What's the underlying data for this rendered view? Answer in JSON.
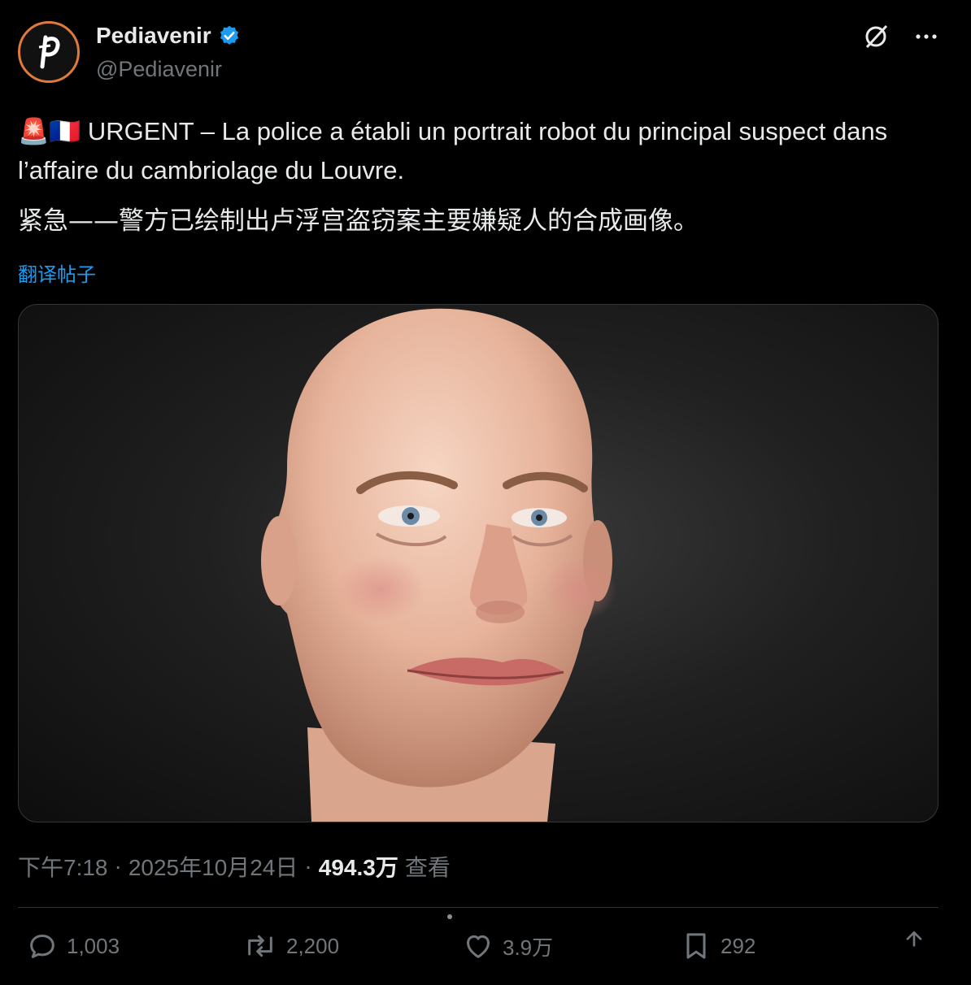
{
  "header": {
    "display_name": "Pediavenir",
    "handle": "@Pediavenir",
    "avatar_letter": "p",
    "verified": true,
    "accent_color": "#1d9bf0"
  },
  "tweet": {
    "emoji_prefix": "🚨🇫🇷",
    "text_fr": "URGENT – La police a établi un portrait robot du principal suspect dans l’affaire du cambriolage du Louvre.",
    "text_zh": "紧急——警方已绘制出卢浮宫盗窃案主要嫌疑人的合成画像。",
    "translate_link": "翻译帖子"
  },
  "meta": {
    "time": "下午7:18",
    "date": "2025年10月24日",
    "views_count": "494.3万",
    "views_label": "查看",
    "separator": "·"
  },
  "actions": {
    "replies": "1,003",
    "reposts": "2,200",
    "likes": "3.9万",
    "bookmarks": "292"
  },
  "icons": [
    "grok-icon",
    "more-icon",
    "reply-icon",
    "repost-icon",
    "like-icon",
    "bookmark-icon",
    "share-icon",
    "verified-badge-icon"
  ]
}
